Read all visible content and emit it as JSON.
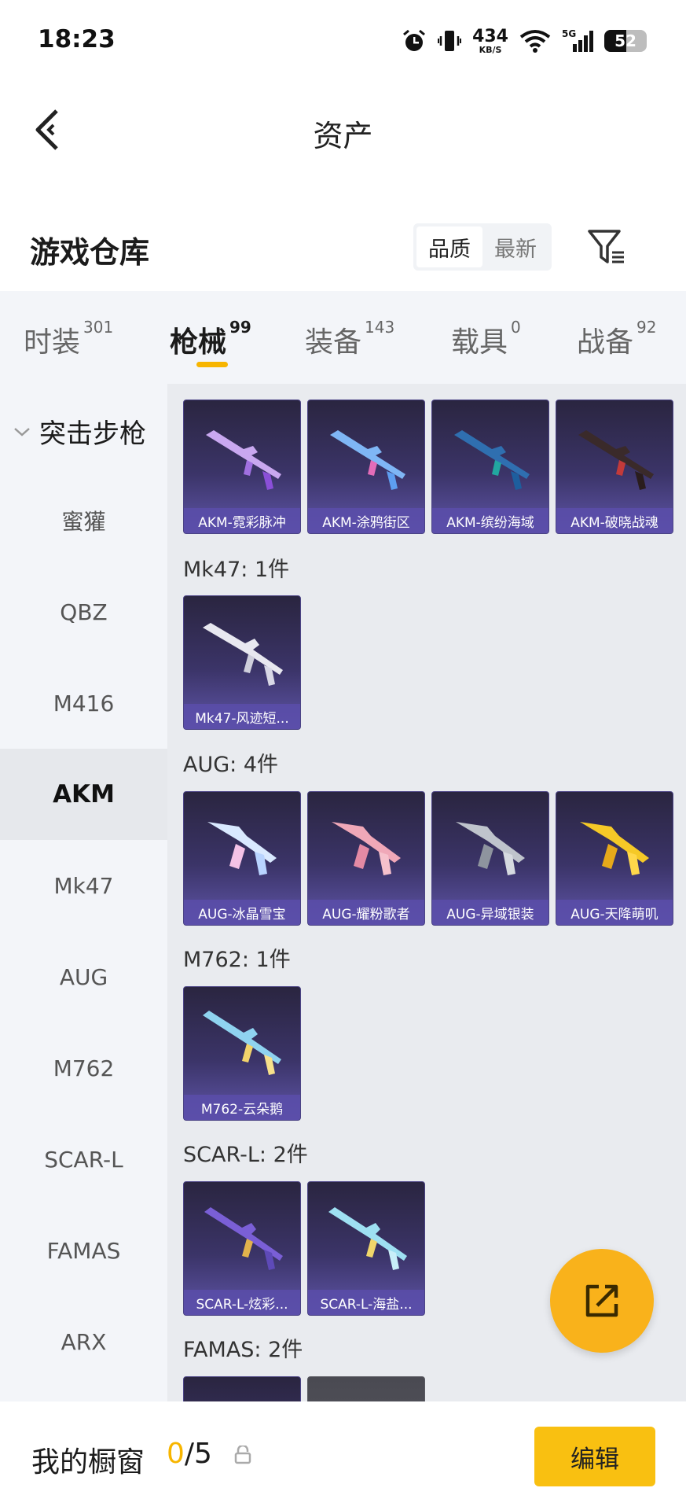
{
  "status_bar": {
    "time": "18:23",
    "net_speed_value": "434",
    "net_speed_unit": "KB/S",
    "network_type": "5G",
    "battery": "52",
    "battery_level": 0.52
  },
  "header": {
    "title": "资产"
  },
  "warehouse": {
    "title": "游戏仓库",
    "sort_options": [
      "品质",
      "最新"
    ],
    "sort_selected": "品质"
  },
  "tabs": [
    {
      "label": "时装",
      "count": "301"
    },
    {
      "label": "枪械",
      "count": "99",
      "active": true
    },
    {
      "label": "装备",
      "count": "143"
    },
    {
      "label": "载具",
      "count": "0"
    },
    {
      "label": "战备",
      "count": "92"
    }
  ],
  "sidebar": {
    "category": "突击步枪",
    "items": [
      "蜜獾",
      "QBZ",
      "M416",
      "AKM",
      "Mk47",
      "AUG",
      "M762",
      "SCAR-L",
      "FAMAS",
      "ARX"
    ],
    "active": "AKM"
  },
  "content": {
    "akm_cards": [
      "AKM-霓彩脉冲",
      "AKM-涂鸦街区",
      "AKM-缤纷海域",
      "AKM-破晓战魂"
    ],
    "groups": [
      {
        "label": "Mk47: 1件",
        "cards": [
          "Mk47-风迹短..."
        ]
      },
      {
        "label": "AUG: 4件",
        "cards": [
          "AUG-冰晶雪宝",
          "AUG-耀粉歌者",
          "AUG-异域银装",
          "AUG-天降萌叽"
        ]
      },
      {
        "label": "M762: 1件",
        "cards": [
          "M762-云朵鹅"
        ]
      },
      {
        "label": "SCAR-L: 2件",
        "cards": [
          "SCAR-L-炫彩...",
          "SCAR-L-海盐..."
        ]
      },
      {
        "label": "FAMAS: 2件",
        "cards": []
      }
    ]
  },
  "bottom_bar": {
    "label": "我的橱窗",
    "current": "0",
    "separator": "/",
    "total": "5",
    "edit_label": "编辑"
  },
  "colors": {
    "accent": "#f7b500",
    "card_bg": "#3b3468",
    "card_caption": "#5a4eaa"
  }
}
